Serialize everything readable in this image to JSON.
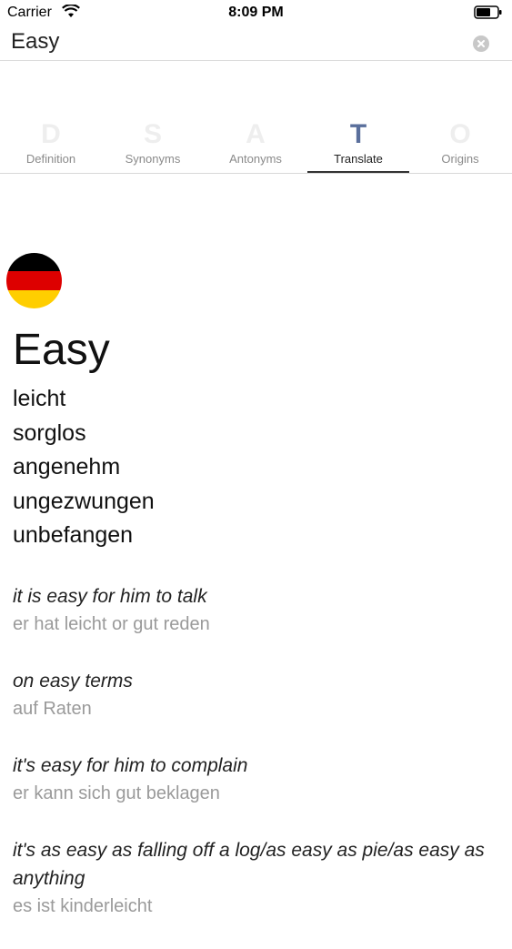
{
  "status_bar": {
    "carrier": "Carrier",
    "time": "8:09 PM"
  },
  "search": {
    "value": "Easy",
    "placeholder": ""
  },
  "tabs": [
    {
      "letter": "D",
      "label": "Definition",
      "active": false
    },
    {
      "letter": "S",
      "label": "Synonyms",
      "active": false
    },
    {
      "letter": "A",
      "label": "Antonyms",
      "active": false
    },
    {
      "letter": "T",
      "label": "Translate",
      "active": true
    },
    {
      "letter": "O",
      "label": "Origins",
      "active": false
    }
  ],
  "translation": {
    "flag_colors": [
      "#000000",
      "#DD0000",
      "#FFCE00"
    ],
    "headword": "Easy",
    "words": [
      "leicht",
      "sorglos",
      "angenehm",
      "ungezwungen",
      "unbefangen"
    ],
    "examples": [
      {
        "en": "it is easy for him to talk",
        "de": "er hat leicht or gut reden"
      },
      {
        "en": "on easy terms",
        "de": "auf Raten"
      },
      {
        "en": "it's easy for him to complain",
        "de": "er kann sich gut beklagen"
      },
      {
        "en": "it's as easy as falling off a log/as easy as pie/as easy as anything",
        "de": "es ist kinderleicht"
      }
    ]
  },
  "colors": {
    "active_tab_letter": "#5a6f9c",
    "inactive_tab_letter": "#eeeeee"
  }
}
